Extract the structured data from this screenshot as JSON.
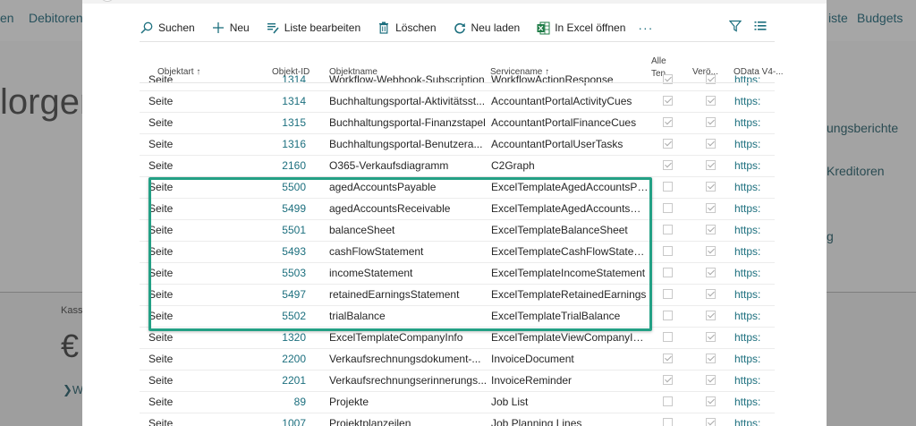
{
  "background": {
    "nav": [
      "Debitoren",
      "en",
      "iste",
      "Budgets"
    ],
    "hero_text": "lorgen",
    "links": [
      "ungsberichte",
      "Kreditoren",
      "g"
    ],
    "small_label": "Kass",
    "currency": "€",
    "bottom_link": "W"
  },
  "toolbar": {
    "search": "Suchen",
    "new": "Neu",
    "edit_list": "Liste bearbeiten",
    "delete": "Löschen",
    "reload": "Neu laden",
    "excel": "In Excel öffnen",
    "more": "···"
  },
  "columns": {
    "object_type": "Objektart ↑",
    "object_id": "Objekt-ID",
    "object_name": "Objektname",
    "service_name": "Servicename ↑",
    "all_tenants_1": "Alle",
    "all_tenants_2": "Ten...",
    "published": "Verö...",
    "odata": "OData V4-..."
  },
  "rows": [
    {
      "type": "Seite",
      "id": "1314",
      "name": "Workflow-Webhook-Subscription",
      "service": "WorkflowActionResponse",
      "all": true,
      "pub": true,
      "url": "https:"
    },
    {
      "type": "Seite",
      "id": "1314",
      "name": "Buchhaltungsportal-Aktivitätsst...",
      "service": "AccountantPortalActivityCues",
      "all": true,
      "pub": true,
      "url": "https:"
    },
    {
      "type": "Seite",
      "id": "1315",
      "name": "Buchhaltungsportal-Finanzstapel",
      "service": "AccountantPortalFinanceCues",
      "all": true,
      "pub": true,
      "url": "https:"
    },
    {
      "type": "Seite",
      "id": "1316",
      "name": "Buchhaltungsportal-Benutzera...",
      "service": "AccountantPortalUserTasks",
      "all": true,
      "pub": true,
      "url": "https:"
    },
    {
      "type": "Seite",
      "id": "2160",
      "name": "O365-Verkaufsdiagramm",
      "service": "C2Graph",
      "all": true,
      "pub": true,
      "url": "https:"
    },
    {
      "type": "Seite",
      "id": "5500",
      "name": "agedAccountsPayable",
      "service": "ExcelTemplateAgedAccountsPa...",
      "all": false,
      "pub": true,
      "url": "https:"
    },
    {
      "type": "Seite",
      "id": "5499",
      "name": "agedAccountsReceivable",
      "service": "ExcelTemplateAgedAccountsRec...",
      "all": false,
      "pub": true,
      "url": "https:"
    },
    {
      "type": "Seite",
      "id": "5501",
      "name": "balanceSheet",
      "service": "ExcelTemplateBalanceSheet",
      "all": false,
      "pub": true,
      "url": "https:"
    },
    {
      "type": "Seite",
      "id": "5493",
      "name": "cashFlowStatement",
      "service": "ExcelTemplateCashFlowStateme...",
      "all": false,
      "pub": true,
      "url": "https:"
    },
    {
      "type": "Seite",
      "id": "5503",
      "name": "incomeStatement",
      "service": "ExcelTemplateIncomeStatement",
      "all": false,
      "pub": true,
      "url": "https:"
    },
    {
      "type": "Seite",
      "id": "5497",
      "name": "retainedEarningsStatement",
      "service": "ExcelTemplateRetainedEarnings",
      "all": false,
      "pub": true,
      "url": "https:"
    },
    {
      "type": "Seite",
      "id": "5502",
      "name": "trialBalance",
      "service": "ExcelTemplateTrialBalance",
      "all": false,
      "pub": true,
      "url": "https:"
    },
    {
      "type": "Seite",
      "id": "1320",
      "name": "ExcelTemplateCompanyInfo",
      "service": "ExcelTemplateViewCompanyInf...",
      "all": false,
      "pub": true,
      "url": "https:"
    },
    {
      "type": "Seite",
      "id": "2200",
      "name": "Verkaufsrechnungsdokument-...",
      "service": "InvoiceDocument",
      "all": true,
      "pub": true,
      "url": "https:"
    },
    {
      "type": "Seite",
      "id": "2201",
      "name": "Verkaufsrechnungserinnerungs...",
      "service": "InvoiceReminder",
      "all": true,
      "pub": true,
      "url": "https:"
    },
    {
      "type": "Seite",
      "id": "89",
      "name": "Projekte",
      "service": "Job List",
      "all": false,
      "pub": true,
      "url": "https:"
    },
    {
      "type": "Seite",
      "id": "1007",
      "name": "Projektplanzeilen",
      "service": "Job Planning Lines",
      "all": false,
      "pub": true,
      "url": "https:"
    }
  ],
  "accent_color": "#23a085",
  "link_color": "#1c6f7e"
}
